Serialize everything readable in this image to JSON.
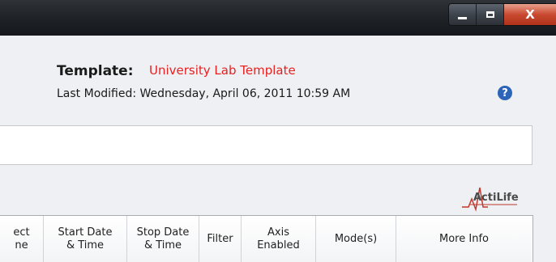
{
  "window": {
    "controls": {
      "minimize_icon": "minimize-icon",
      "maximize_icon": "maximize-icon",
      "close_glyph": "X"
    }
  },
  "template": {
    "label": "Template:",
    "name": "University Lab Template",
    "name_color": "#e42222",
    "last_modified": "Last Modified: Wednesday, April 06, 2011 10:59 AM"
  },
  "help": {
    "icon": "help-icon",
    "glyph": "?"
  },
  "logo": {
    "text": "ActiLife"
  },
  "table": {
    "columns": [
      "ect\nne",
      "Start Date\n& Time",
      "Stop Date\n& Time",
      "Filter",
      "Axis\nEnabled",
      "Mode(s)",
      "More Info"
    ]
  }
}
